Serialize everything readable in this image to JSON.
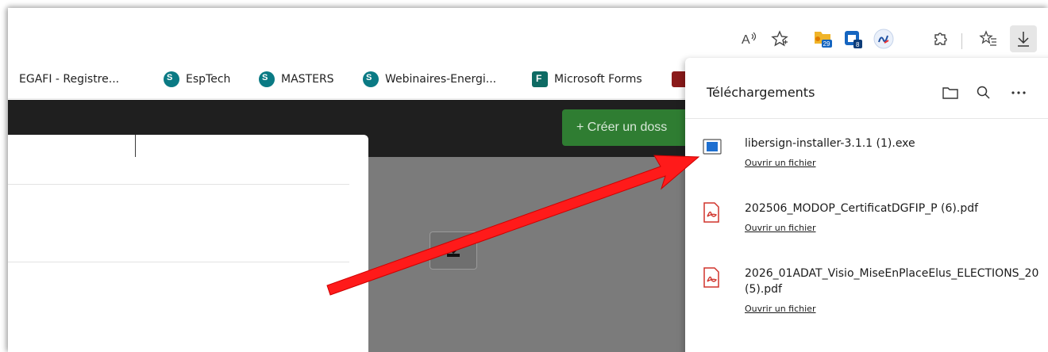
{
  "toolbar": {
    "icons": [
      "read-aloud-icon",
      "favorite-star-icon",
      "extension-rss-icon",
      "extension-calendar-icon",
      "extension-signature-icon",
      "extensions-puzzle-icon",
      "favorites-list-icon",
      "downloads-icon"
    ],
    "badge_rss": "29",
    "badge_cal": "8",
    "read_aloud_glyph": "A"
  },
  "bookmarks": [
    {
      "label": "EGAFI - Registre...",
      "icon": "none"
    },
    {
      "label": "EspTech",
      "icon": "sharepoint-icon"
    },
    {
      "label": "MASTERS",
      "icon": "sharepoint-icon"
    },
    {
      "label": "Webinaires-Energi...",
      "icon": "sharepoint-icon"
    },
    {
      "label": "Microsoft Forms",
      "icon": "forms-icon"
    }
  ],
  "page": {
    "create_button": "+ Créer un doss"
  },
  "downloads": {
    "title": "Téléchargements",
    "items": [
      {
        "name": "libersign-installer-3.1.1 (1).exe",
        "link": "Ouvrir un fichier",
        "type": "exe"
      },
      {
        "name": "202506_MODOP_CertificatDGFIP_P (6).pdf",
        "link": "Ouvrir un fichier",
        "type": "pdf"
      },
      {
        "name_line1": "2026_01ADAT_Visio_MiseEnPlaceElus_ELECTIONS_20",
        "name_line2": "(5).pdf",
        "link": "Ouvrir un fichier",
        "type": "pdf"
      }
    ]
  },
  "colors": {
    "arrow": "#ff1a1a",
    "create_button": "#2f7d32",
    "pdf_red": "#d0342c",
    "exe_blue": "#1e6fd0"
  }
}
